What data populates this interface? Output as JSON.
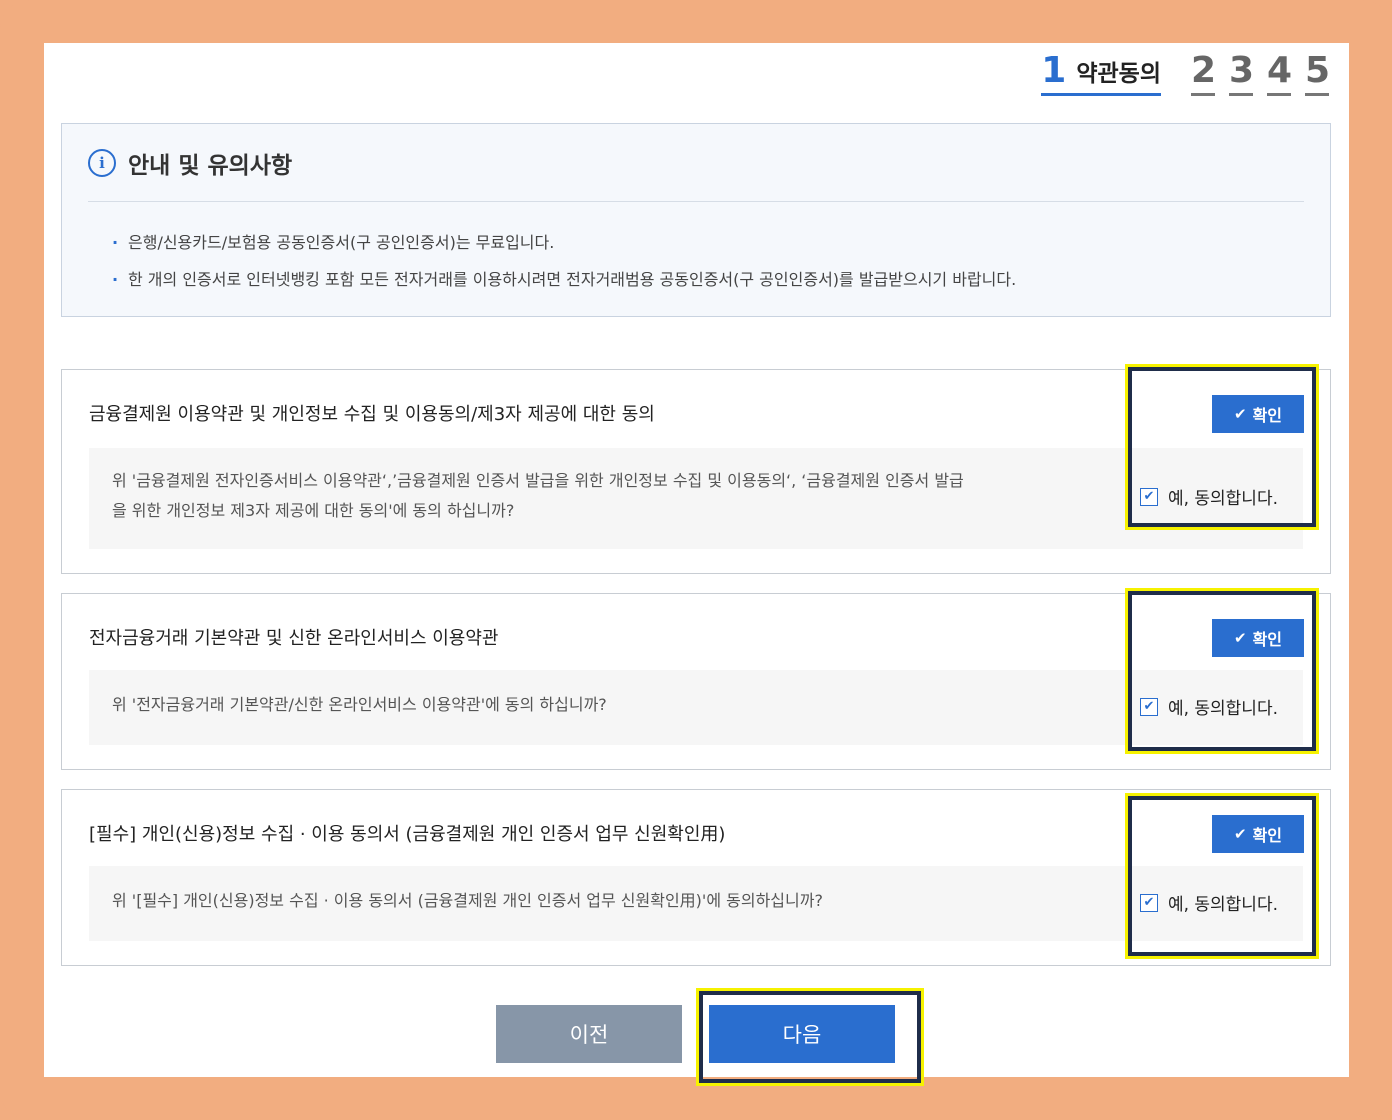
{
  "steps": {
    "active_number": "1",
    "active_label": "약관동의",
    "others": [
      "2",
      "3",
      "4",
      "5"
    ]
  },
  "notice": {
    "icon": "info-icon",
    "title": "안내 및 유의사항",
    "items": [
      "은행/신용카드/보험용 공동인증서(구 공인인증서)는 무료입니다.",
      "한 개의 인증서로 인터넷뱅킹 포함 모든 전자거래를 이용하시려면 전자거래범용 공동인증서(구 공인인증서)를 발급받으시기 바랍니다."
    ]
  },
  "agreements": [
    {
      "title": "금융결제원 이용약관 및 개인정보 수집 및 이용동의/제3자 제공에 대한 동의",
      "desc_lines": [
        "위 '금융결제원 전자인증서비스 이용약관‘,’금융결제원 인증서 발급을 위한 개인정보 수집 및 이용동의‘, ‘금융결제원 인증서 발급",
        "을 위한 개인정보 제3자 제공에 대한 동의'에 동의 하십니까?"
      ],
      "confirm_label": "확인",
      "agree_label": "예, 동의합니다.",
      "checked": true
    },
    {
      "title": "전자금융거래 기본약관 및 신한 온라인서비스 이용약관",
      "desc_lines": [
        "위 '전자금융거래 기본약관/신한 온라인서비스 이용약관'에 동의 하십니까?"
      ],
      "confirm_label": "확인",
      "agree_label": "예, 동의합니다.",
      "checked": true
    },
    {
      "title": "[필수] 개인(신용)정보 수집 · 이용 동의서 (금융결제원 개인 인증서 업무 신원확인用)",
      "desc_lines": [
        "위 '[필수] 개인(신용)정보 수집 · 이용 동의서 (금융결제원 개인 인증서 업무 신원확인用)'에 동의하십니까?"
      ],
      "confirm_label": "확인",
      "agree_label": "예, 동의합니다.",
      "checked": true
    }
  ],
  "buttons": {
    "prev": "이전",
    "next": "다음"
  },
  "colors": {
    "accent": "#2a6ecf",
    "frame": "#f2ad80",
    "prev_button": "#8796a8",
    "highlight": "#f6f200"
  }
}
